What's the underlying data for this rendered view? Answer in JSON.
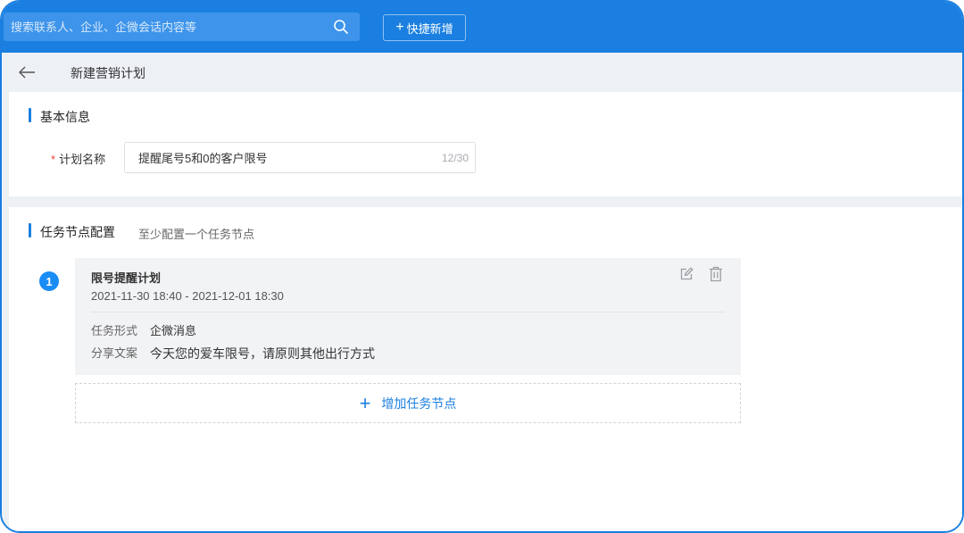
{
  "search": {
    "placeholder": "搜索联系人、企业、企微会话内容等"
  },
  "toolbar": {
    "quick_add_label": "快捷新增",
    "quick_add_plus": "+"
  },
  "header": {
    "title": "新建营销计划"
  },
  "basic_info": {
    "section_title": "基本信息",
    "plan_name_required": "*",
    "plan_name_label": "计划名称",
    "plan_name_value": "提醒尾号5和0的客户限号",
    "plan_name_counter": "12/30"
  },
  "task_config": {
    "section_title": "任务节点配置",
    "hint": "至少配置一个任务节点",
    "nodes": [
      {
        "index": "1",
        "name": "限号提醒计划",
        "time_range": "2021-11-30 18:40 - 2021-12-01 18:30",
        "form_label": "任务形式",
        "form_value": "企微消息",
        "copy_label": "分享文案",
        "copy_value": "今天您的爱车限号，请原则其他出行方式"
      }
    ],
    "add_node_plus": "+",
    "add_node_label": "增加任务节点"
  },
  "colors": {
    "primary": "#1a7fe0",
    "page_bg": "#edf0f5",
    "node_bg": "#f2f3f5",
    "required": "#f04040"
  }
}
